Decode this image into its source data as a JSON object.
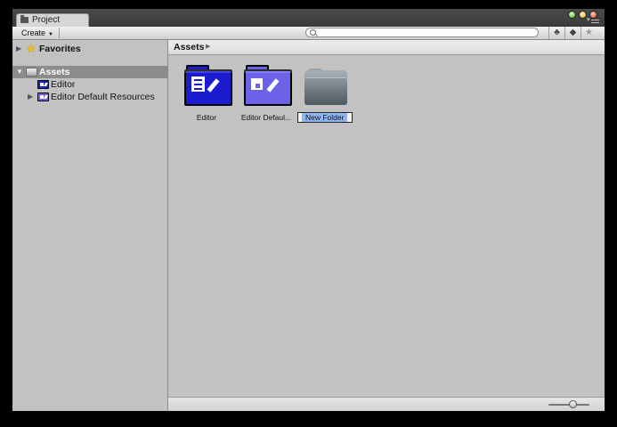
{
  "window": {
    "tab_label": "Project",
    "controls": [
      "green",
      "yellow",
      "red"
    ]
  },
  "toolbar": {
    "create_label": "Create",
    "search_placeholder": "",
    "icons": [
      "search-by-type-icon",
      "tag-icon",
      "star-icon"
    ]
  },
  "sidebar": {
    "favorites_label": "Favorites",
    "assets_label": "Assets",
    "items": [
      {
        "label": "Editor",
        "icon": "editor-folder-icon"
      },
      {
        "label": "Editor Default Resources",
        "icon": "editor-default-resources-folder-icon"
      }
    ]
  },
  "breadcrumb": {
    "path": "Assets"
  },
  "grid": {
    "items": [
      {
        "label": "Editor",
        "icon": "editor-folder-icon"
      },
      {
        "label": "Editor Default Resources",
        "display_label": "Editor Defaul...",
        "icon": "editor-default-resources-folder-icon"
      },
      {
        "label": "New Folder",
        "icon": "folder-icon",
        "renaming": true
      }
    ]
  },
  "zoom": {
    "level": 0.6
  },
  "colors": {
    "editor_folder": "#1b1bd0",
    "resources_folder": "#6b62e8",
    "selection": "#8eb6f2"
  }
}
